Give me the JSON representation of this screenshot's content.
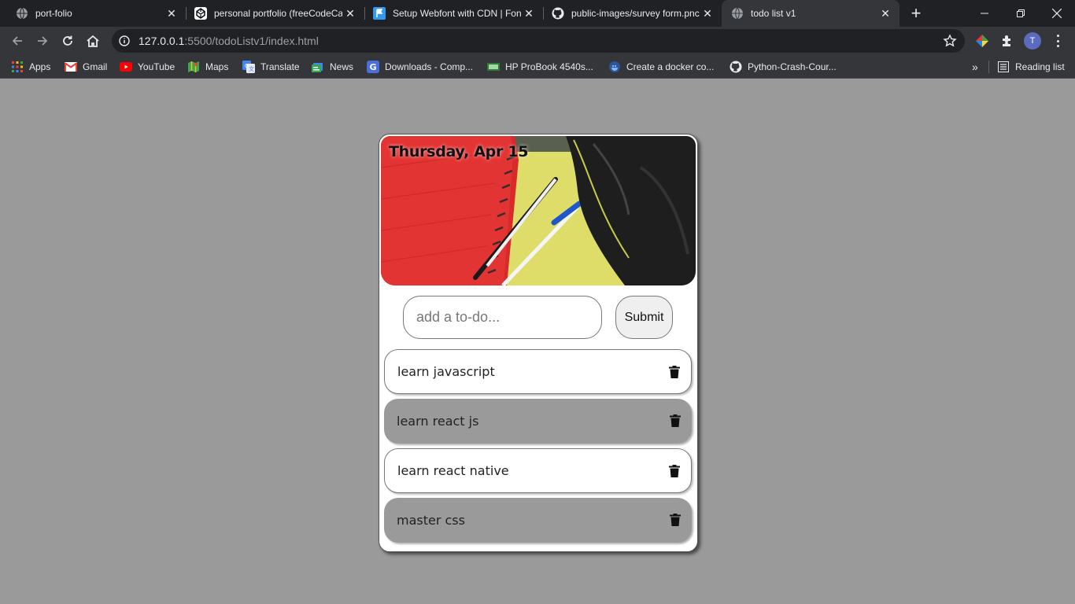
{
  "browser": {
    "tabs": [
      {
        "title": "port-folio",
        "icon": "globe-icon",
        "active": false
      },
      {
        "title": "personal portfolio (freeCodeCa",
        "icon": "codepen-icon",
        "active": false
      },
      {
        "title": "Setup Webfont with CDN | Fon",
        "icon": "flag-icon",
        "active": false
      },
      {
        "title": "public-images/survey form.pnc",
        "icon": "github-icon",
        "active": false
      },
      {
        "title": "todo list v1",
        "icon": "globe-icon",
        "active": true
      }
    ],
    "url_host": "127.0.0.1",
    "url_path": ":5500/todoListv1/index.html",
    "profile_initial": "T",
    "bookmarks": [
      {
        "label": "Apps",
        "icon": "apps-grid-icon"
      },
      {
        "label": "Gmail",
        "icon": "gmail-icon"
      },
      {
        "label": "YouTube",
        "icon": "youtube-icon"
      },
      {
        "label": "Maps",
        "icon": "maps-icon"
      },
      {
        "label": "Translate",
        "icon": "translate-icon"
      },
      {
        "label": "News",
        "icon": "news-icon"
      },
      {
        "label": "Downloads - Comp...",
        "icon": "downloads-icon"
      },
      {
        "label": "HP ProBook 4540s...",
        "icon": "laptop-icon"
      },
      {
        "label": "Create a docker co...",
        "icon": "docker-icon"
      },
      {
        "label": "Python-Crash-Cour...",
        "icon": "github-icon"
      }
    ],
    "overflow_label": "»",
    "reading_list_label": "Reading list"
  },
  "app": {
    "date": "Thursday, Apr 15",
    "input_placeholder": "add a to-do...",
    "submit_label": "Submit",
    "todos": [
      {
        "text": "learn javascript",
        "style": "white"
      },
      {
        "text": "learn react js",
        "style": "grey"
      },
      {
        "text": "learn react native",
        "style": "white"
      },
      {
        "text": "master css",
        "style": "grey"
      }
    ]
  },
  "colors": {
    "page_background": "#9a9a9a",
    "card_background": "#ffffff",
    "grey_item": "#9a9a9a",
    "chrome_dark": "#202124",
    "chrome_toolbar": "#35363a"
  }
}
